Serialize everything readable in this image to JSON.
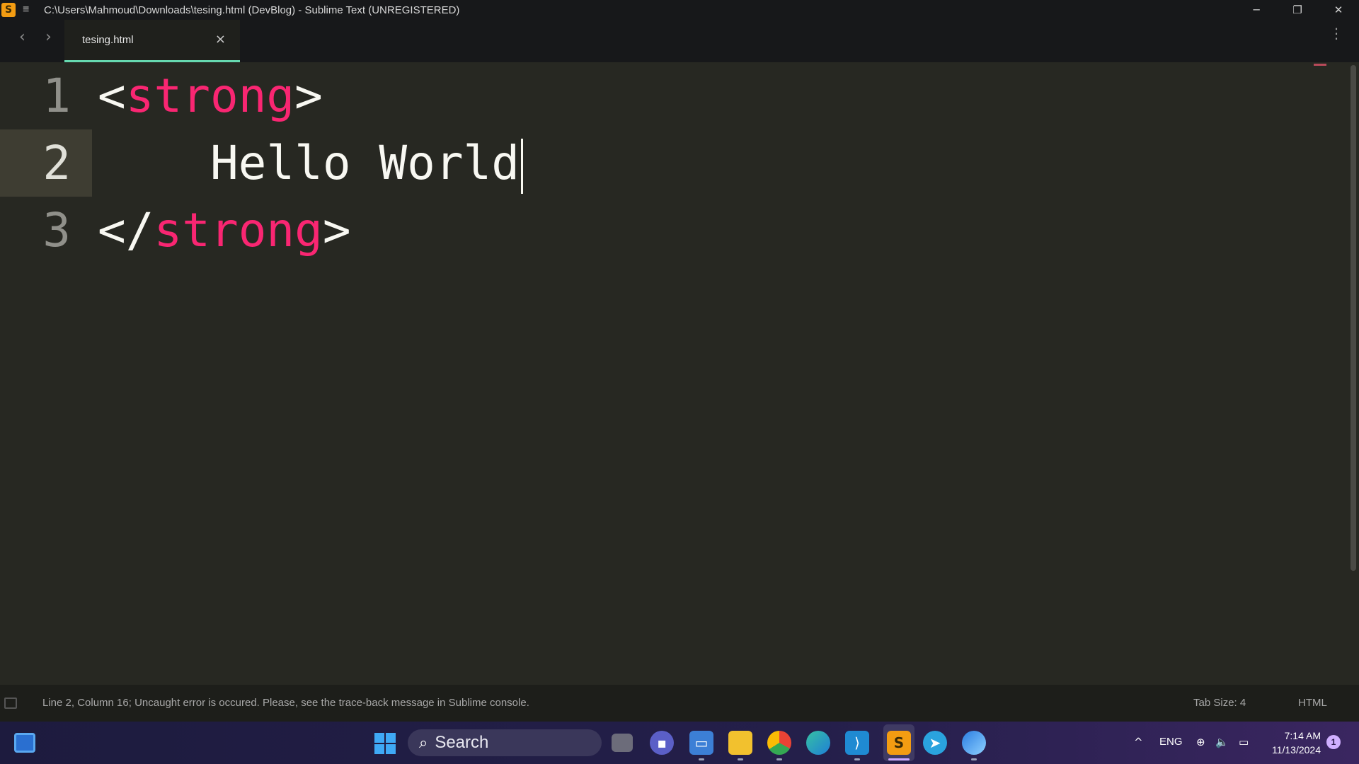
{
  "window": {
    "title": "C:\\Users\\Mahmoud\\Downloads\\tesing.html (DevBlog) - Sublime Text (UNREGISTERED)",
    "minimize": "─",
    "maximize": "❐",
    "close": "✕"
  },
  "tabs": [
    {
      "label": "tesing.html",
      "close": "×",
      "active": true
    }
  ],
  "nav": {
    "back": "‹",
    "forward": "›",
    "more": "⋮"
  },
  "editor": {
    "lines": [
      {
        "number": "1",
        "open": "<",
        "tag": "strong",
        "close": ">",
        "text": ""
      },
      {
        "number": "2",
        "text": "    Hello World",
        "current": true
      },
      {
        "number": "3",
        "open": "</",
        "tag": "strong",
        "close": ">",
        "text": ""
      }
    ],
    "colors": {
      "background": "#272822",
      "tag": "#f92672",
      "text": "#f8f8f2"
    }
  },
  "status": {
    "message": "Line 2, Column 16;  Uncaught error is occured. Please, see the trace-back message in Sublime console.",
    "tab_size": "Tab Size: 4",
    "syntax": "HTML"
  },
  "taskbar": {
    "search_label": "Search",
    "apps": [
      "task-view",
      "teams-chat",
      "remote-desktop",
      "file-explorer",
      "chrome",
      "edge",
      "vscode",
      "sublime-text",
      "telegram",
      "firefox"
    ],
    "tray": {
      "chevron": "^",
      "language": "ENG",
      "time": "7:14 AM",
      "date": "11/13/2024",
      "notifications": "1"
    }
  }
}
